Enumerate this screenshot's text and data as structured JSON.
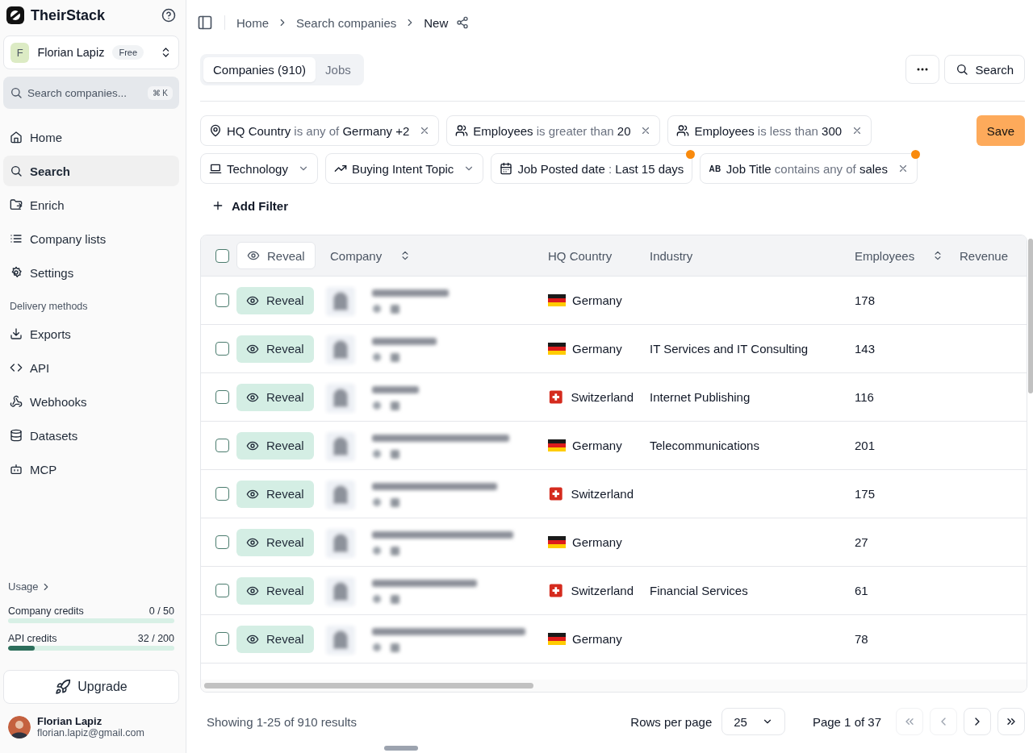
{
  "sidebar": {
    "brand": "TheirStack",
    "workspace": {
      "initial": "F",
      "name": "Florian Lapiz",
      "plan": "Free"
    },
    "search": {
      "placeholder": "Search companies...",
      "shortcut": "⌘ K"
    },
    "nav": [
      {
        "label": "Home",
        "selected": false
      },
      {
        "label": "Search",
        "selected": true
      },
      {
        "label": "Enrich",
        "selected": false
      },
      {
        "label": "Company lists",
        "selected": false
      },
      {
        "label": "Settings",
        "selected": false
      }
    ],
    "section_title": "Delivery methods",
    "delivery": [
      {
        "label": "Exports",
        "selected": false
      },
      {
        "label": "API",
        "selected": false
      },
      {
        "label": "Webhooks",
        "selected": false
      },
      {
        "label": "Datasets",
        "selected": false
      },
      {
        "label": "MCP",
        "selected": false
      }
    ],
    "usage": {
      "title": "Usage",
      "credits": [
        {
          "label": "Company credits",
          "reading": "0 / 50",
          "level": 0
        },
        {
          "label": "API credits",
          "reading": "32 / 200",
          "level": 0.16
        }
      ]
    },
    "upgrade": "Upgrade",
    "user": {
      "name": "Florian Lapiz",
      "email": "florian.lapiz@gmail.com"
    }
  },
  "breadcrumb": [
    "Home",
    "Search companies",
    "New"
  ],
  "tabs": [
    {
      "label": "Companies (910)",
      "selected": true
    },
    {
      "label": "Jobs",
      "selected": false
    }
  ],
  "search_button": "Search",
  "save_button": "Save",
  "filters": [
    [
      {
        "kind": "location",
        "field": "HQ Country",
        "operator": "is any of",
        "value": "Germany +2",
        "removable": true
      },
      {
        "kind": "people",
        "field": "Employees",
        "operator": "is greater than",
        "value": "20",
        "removable": true
      },
      {
        "kind": "people",
        "field": "Employees",
        "operator": "is less than",
        "value": "300",
        "removable": true
      }
    ],
    [
      {
        "kind": "laptop",
        "field": "Technology",
        "dropdown": true
      },
      {
        "kind": "trend",
        "field": "Buying Intent Topic",
        "dropdown": true
      },
      {
        "kind": "calendar",
        "field": "Job Posted date",
        "operator": ":",
        "value": "Last 15 days",
        "changed": true
      },
      {
        "kind": "text",
        "icon_text": "AB",
        "field": "Job Title",
        "operator": "contains any of",
        "value": "sales",
        "removable": true,
        "changed": true
      }
    ]
  ],
  "add_filter": "Add Filter",
  "table": {
    "select_all_checked": false,
    "reveal_header": "Reveal",
    "columns": [
      {
        "label": "Company",
        "sortable": true
      },
      {
        "label": "HQ Country"
      },
      {
        "label": "Industry"
      },
      {
        "label": "Employees",
        "sortable": true
      },
      {
        "label": "Revenue"
      }
    ],
    "rows": [
      {
        "selected": false,
        "reveal": "Reveal",
        "kind": "de",
        "country": "Germany",
        "employees": "178"
      },
      {
        "selected": false,
        "reveal": "Reveal",
        "kind": "de",
        "country": "Germany",
        "industry": "IT Services and IT Consulting",
        "employees": "143"
      },
      {
        "selected": false,
        "reveal": "Reveal",
        "kind": "ch",
        "country": "Switzerland",
        "industry": "Internet Publishing",
        "employees": "116"
      },
      {
        "selected": false,
        "reveal": "Reveal",
        "kind": "de",
        "country": "Germany",
        "industry": "Telecommunications",
        "employees": "201"
      },
      {
        "selected": false,
        "reveal": "Reveal",
        "kind": "ch",
        "country": "Switzerland",
        "employees": "175"
      },
      {
        "selected": false,
        "reveal": "Reveal",
        "kind": "de",
        "country": "Germany",
        "employees": "27"
      },
      {
        "selected": false,
        "reveal": "Reveal",
        "kind": "ch",
        "country": "Switzerland",
        "industry": "Financial Services",
        "employees": "61"
      },
      {
        "selected": false,
        "reveal": "Reveal",
        "kind": "de",
        "country": "Germany",
        "employees": "78"
      }
    ]
  },
  "footer": {
    "summary": "Showing 1-25 of 910 results",
    "rows_label": "Rows per page",
    "rows_value": "25",
    "page": "Page 1 of 37",
    "nav": [
      {
        "kind": "first",
        "disabled": true
      },
      {
        "kind": "prev",
        "disabled": true
      },
      {
        "kind": "next",
        "disabled": false
      },
      {
        "kind": "last",
        "disabled": false
      }
    ]
  }
}
